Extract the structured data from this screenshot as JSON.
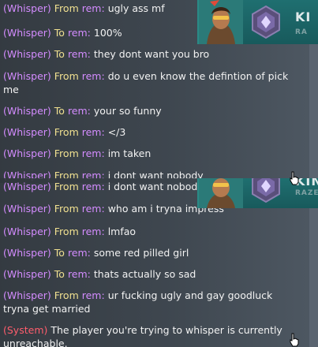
{
  "chat_top": [
    {
      "tag": "(Whisper)",
      "dir": "From",
      "who": "rem:",
      "text": "ugly ass mf"
    },
    {
      "tag": "(Whisper)",
      "dir": "To",
      "who": "rem:",
      "text": "100%"
    },
    {
      "tag": "(Whisper)",
      "dir": "To",
      "who": "rem:",
      "text": "they dont want you bro"
    },
    {
      "tag": "(Whisper)",
      "dir": "From",
      "who": "rem:",
      "text": "do u even know the defintion of pick me"
    },
    {
      "tag": "(Whisper)",
      "dir": "To",
      "who": "rem:",
      "text": "your so funny"
    },
    {
      "tag": "(Whisper)",
      "dir": "From",
      "who": "rem:",
      "text": "</3"
    },
    {
      "tag": "(Whisper)",
      "dir": "From",
      "who": "rem:",
      "text": "im taken"
    },
    {
      "tag": "(Whisper)",
      "dir": "From",
      "who": "rem:",
      "text": "i dont want nobody"
    }
  ],
  "chat_bottom": [
    {
      "tag": "(Whisper)",
      "dir": "From",
      "who": "rem:",
      "text": "i dont want nobody"
    },
    {
      "tag": "(Whisper)",
      "dir": "From",
      "who": "rem:",
      "text": "who am i tryna impress"
    },
    {
      "tag": "(Whisper)",
      "dir": "From",
      "who": "rem:",
      "text": "lmfao"
    },
    {
      "tag": "(Whisper)",
      "dir": "To",
      "who": "rem:",
      "text": "some red pilled girl"
    },
    {
      "tag": "(Whisper)",
      "dir": "To",
      "who": "rem:",
      "text": "thats actually so sad"
    },
    {
      "tag": "(Whisper)",
      "dir": "From",
      "who": "rem:",
      "text": "ur fucking ugly and gay goodluck tryna get married"
    },
    {
      "tag": "(System)",
      "dir": "",
      "who": "",
      "text": "The player you're trying to whisper is currently unreachable."
    }
  ],
  "player_card": {
    "name_fragment_top": "KI",
    "sub_fragment_top": "RA",
    "name_fragment_bottom": "KIN",
    "sub_fragment_bottom": "RAZE",
    "accent_color": "#1f6f70",
    "portrait_icon": "agent-portrait-icon",
    "rank_icon": "rank-badge-icon"
  },
  "colors": {
    "whisper_tag": "#d48cff",
    "system_tag": "#ff5d6d",
    "direction": "#f0e090",
    "text": "#f2f2f2"
  }
}
